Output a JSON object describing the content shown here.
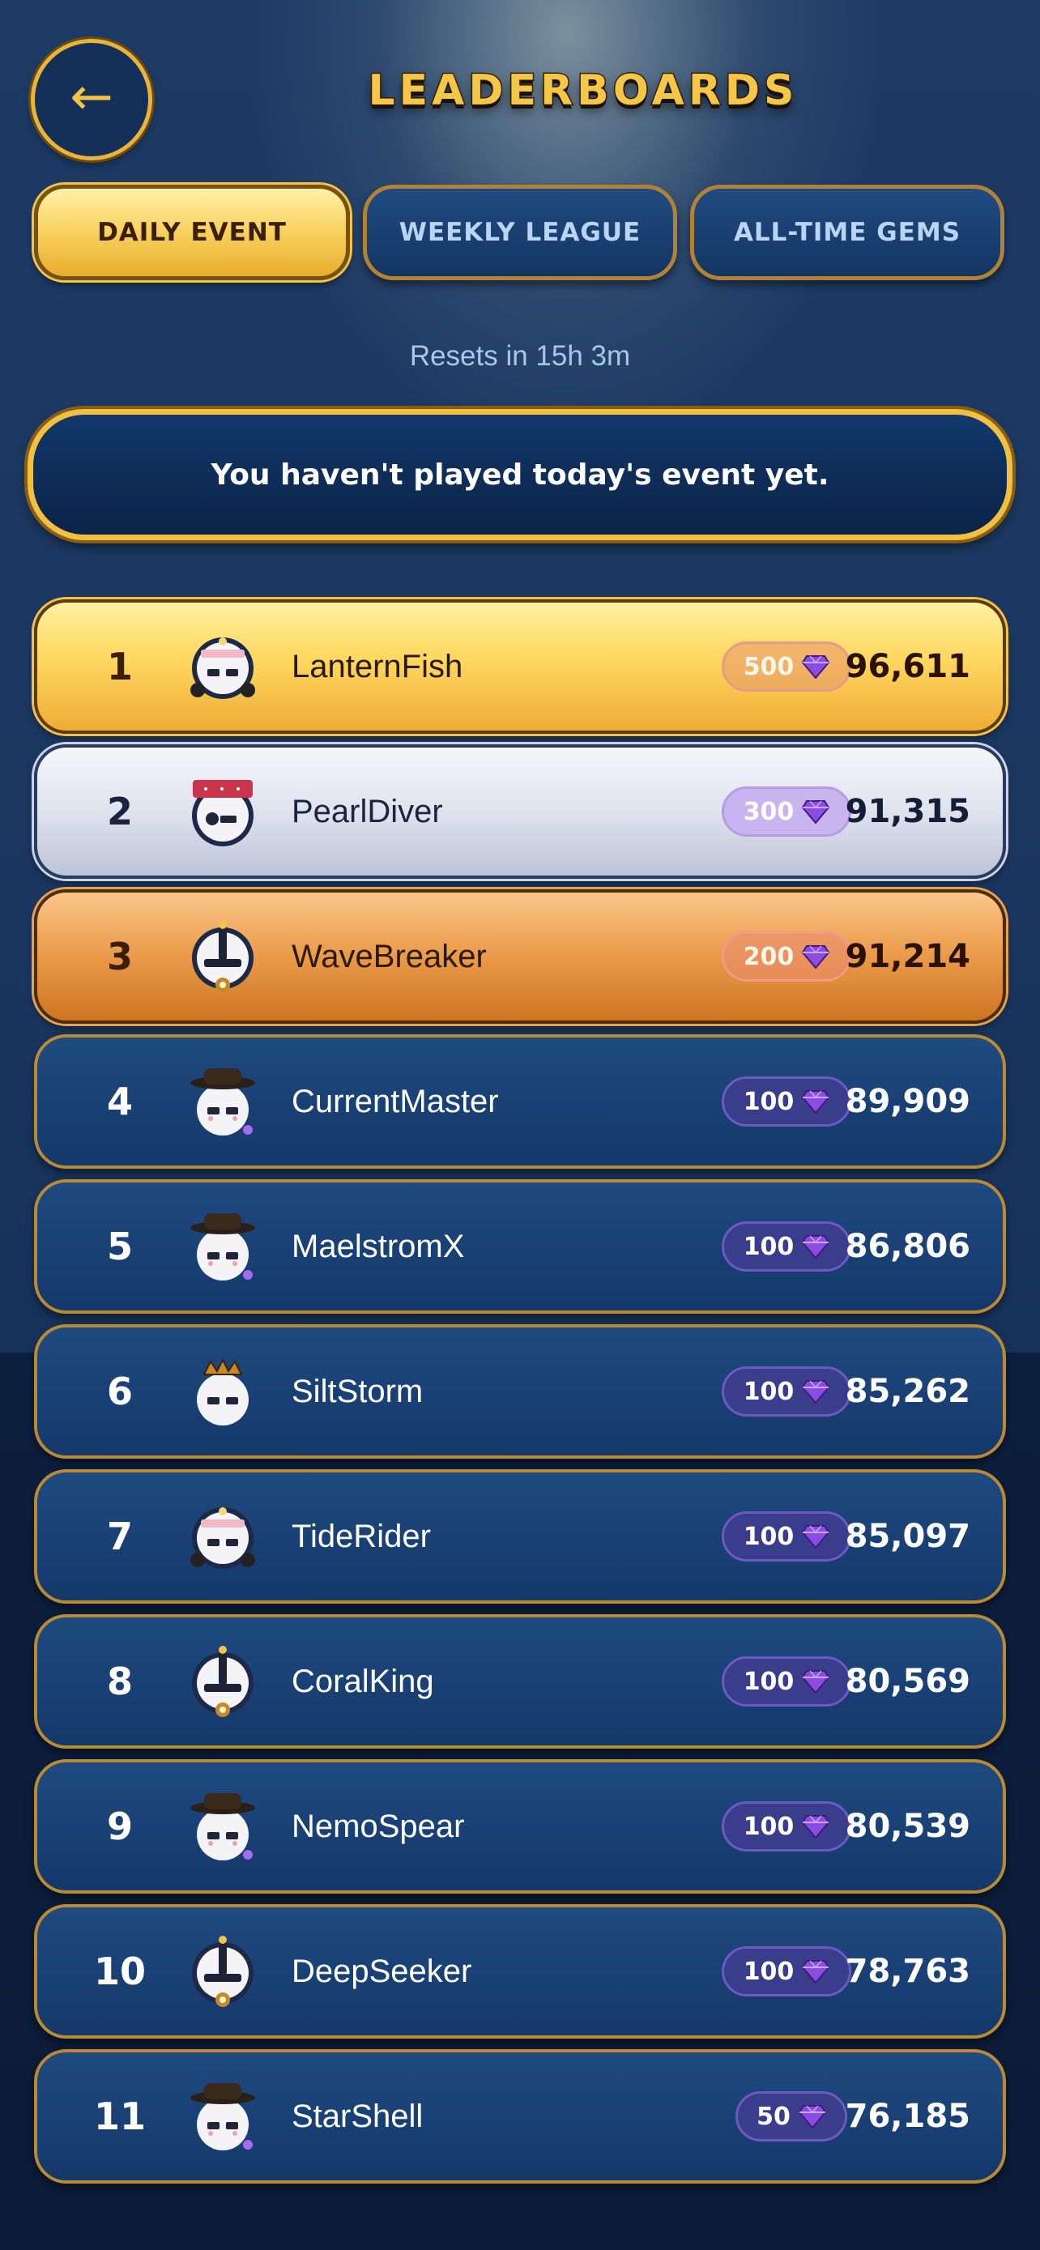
{
  "header": {
    "back_icon": "back-arrow-icon",
    "back_glyph": "←",
    "title": "LEADERBOARDS"
  },
  "tabs": [
    {
      "label": "DAILY EVENT",
      "active": true
    },
    {
      "label": "WEEKLY LEAGUE",
      "active": false
    },
    {
      "label": "ALL-TIME GEMS",
      "active": false
    }
  ],
  "resets_text": "Resets in 15h 3m",
  "notice": "You haven't played today's event yet.",
  "colors": {
    "accent_gold": "#f0c043",
    "background": "#1a3760",
    "gem_purple": "#8a4de0"
  },
  "leaderboard": [
    {
      "rank": "1",
      "name": "LanternFish",
      "reward": "500",
      "score": "96,611",
      "tier": "gold",
      "avatar": "headband"
    },
    {
      "rank": "2",
      "name": "PearlDiver",
      "reward": "300",
      "score": "91,315",
      "tier": "silver",
      "avatar": "bandana"
    },
    {
      "rank": "3",
      "name": "WaveBreaker",
      "reward": "200",
      "score": "91,214",
      "tier": "bronze",
      "avatar": "knight"
    },
    {
      "rank": "4",
      "name": "CurrentMaster",
      "reward": "100",
      "score": "89,909",
      "tier": "normal",
      "avatar": "hat"
    },
    {
      "rank": "5",
      "name": "MaelstromX",
      "reward": "100",
      "score": "86,806",
      "tier": "normal",
      "avatar": "hat"
    },
    {
      "rank": "6",
      "name": "SiltStorm",
      "reward": "100",
      "score": "85,262",
      "tier": "normal",
      "avatar": "crown"
    },
    {
      "rank": "7",
      "name": "TideRider",
      "reward": "100",
      "score": "85,097",
      "tier": "normal",
      "avatar": "headband"
    },
    {
      "rank": "8",
      "name": "CoralKing",
      "reward": "100",
      "score": "80,569",
      "tier": "normal",
      "avatar": "knight"
    },
    {
      "rank": "9",
      "name": "NemoSpear",
      "reward": "100",
      "score": "80,539",
      "tier": "normal",
      "avatar": "hat"
    },
    {
      "rank": "10",
      "name": "DeepSeeker",
      "reward": "100",
      "score": "78,763",
      "tier": "normal",
      "avatar": "knight"
    },
    {
      "rank": "11",
      "name": "StarShell",
      "reward": "50",
      "score": "76,185",
      "tier": "normal",
      "avatar": "hat"
    }
  ]
}
